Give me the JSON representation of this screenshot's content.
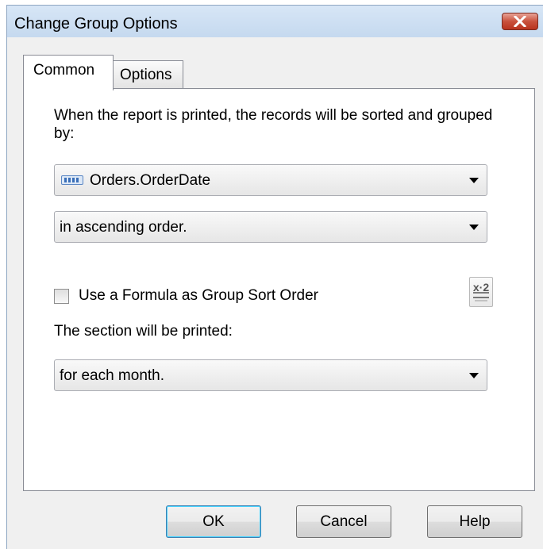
{
  "window": {
    "title": "Change Group Options",
    "close_label": "✕"
  },
  "tabs": [
    {
      "label": "Common",
      "active": true
    },
    {
      "label": "Options",
      "active": false
    }
  ],
  "common": {
    "description": "When the report is printed, the records will be sorted and grouped by:",
    "group_field": {
      "value": "Orders.OrderDate",
      "icon": "database-field-icon"
    },
    "sort_order": {
      "value": "in ascending order."
    },
    "formula_checkbox": {
      "label": "Use a Formula as Group Sort Order",
      "checked": false
    },
    "formula_button": {
      "icon": "formula-editor-icon",
      "glyph": "x·2"
    },
    "section_label": "The section will be printed:",
    "section_frequency": {
      "value": "for each month."
    }
  },
  "buttons": {
    "ok": "OK",
    "cancel": "Cancel",
    "help": "Help"
  }
}
